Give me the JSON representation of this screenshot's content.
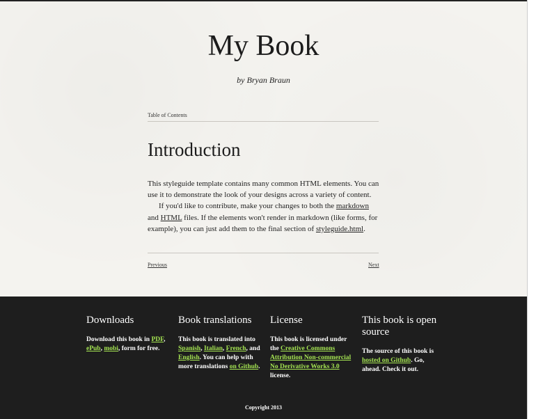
{
  "book": {
    "title": "My Book",
    "author": "by Bryan Braun",
    "toc_label": "Table of Contents",
    "chapter_title": "Introduction",
    "para1": "This styleguide template contains many common HTML elements. You can use it to demonstrate the look of your designs across a variety of content.",
    "para2": {
      "t1": "If you'd like to contribute, make your changes to both the ",
      "link1": "markdown",
      "t2": " and ",
      "link2": "HTML",
      "t3": " files. If the elements won't render in markdown (like forms, for example), you can just add them to the final section of ",
      "link3": "styleguide.html",
      "t4": "."
    },
    "nav": {
      "previous": "Previous",
      "next": "Next"
    }
  },
  "footer": {
    "downloads": {
      "heading": "Downloads",
      "t1": "Download this book in ",
      "pdf": "PDF",
      "sep1": ", ",
      "epub": "ePub",
      "sep2": ", ",
      "mobi": "mobi",
      "t2": ", form for free."
    },
    "translations": {
      "heading": "Book translations",
      "t1": "This book is translated into ",
      "spanish": "Spanish",
      "sep1": ", ",
      "italian": "Italian",
      "sep2": ", ",
      "french": "French",
      "t2": ", and ",
      "english": "English",
      "t3": ". You can help with more translations ",
      "github": "on Github",
      "t4": "."
    },
    "license": {
      "heading": "License",
      "t1": "This book is licensed under the ",
      "link": "Creative Commons Attribution Non-commercial No Derivative Works 3.0",
      "t2": " license."
    },
    "opensource": {
      "heading": "This book is open source",
      "t1": "The source of this book is ",
      "link": "hosted on Github",
      "t2": ". Go, ahead. Check it out."
    },
    "copyright": "Copyright 2013"
  },
  "colors": {
    "link_green": "#a4e352",
    "footer_bg": "#1e1e1e",
    "page_bg": "#f4f3ef"
  }
}
